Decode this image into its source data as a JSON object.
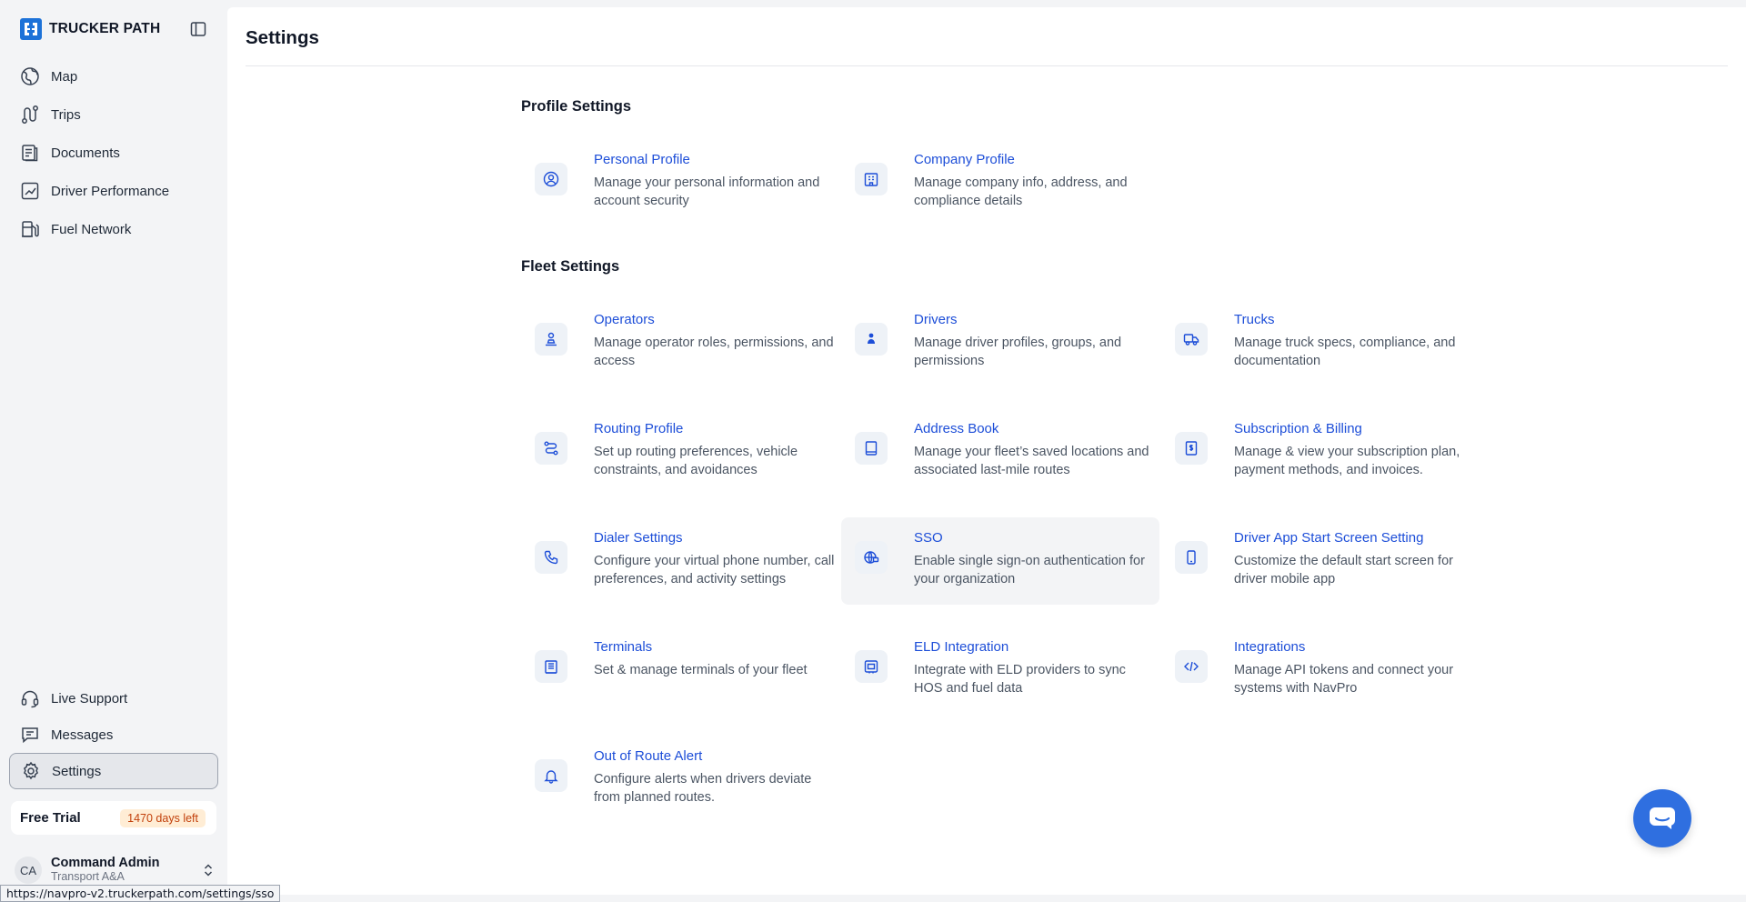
{
  "app": {
    "brand_name": "TRUCKER PATH"
  },
  "sidebar": {
    "items": [
      {
        "label": "Map",
        "icon": "globe-icon"
      },
      {
        "label": "Trips",
        "icon": "route-icon"
      },
      {
        "label": "Documents",
        "icon": "documents-icon"
      },
      {
        "label": "Driver Performance",
        "icon": "chart-icon"
      },
      {
        "label": "Fuel Network",
        "icon": "fuel-icon"
      }
    ],
    "bottom_items": [
      {
        "label": "Live Support",
        "icon": "headset-icon"
      },
      {
        "label": "Messages",
        "icon": "message-icon"
      },
      {
        "label": "Settings",
        "icon": "gear-icon",
        "active": true
      }
    ],
    "trial": {
      "label": "Free Trial",
      "badge": "1470 days left"
    },
    "user": {
      "initials": "CA",
      "name": "Command Admin",
      "org": "Transport A&A"
    }
  },
  "status_bar": {
    "url": "https://navpro-v2.truckerpath.com/settings/sso"
  },
  "page": {
    "title": "Settings",
    "profile_section": {
      "title": "Profile Settings",
      "cards": [
        {
          "title": "Personal Profile",
          "desc": "Manage your personal information and account security",
          "icon": "user-circle-icon"
        },
        {
          "title": "Company Profile",
          "desc": "Manage company info, address, and compliance details",
          "icon": "building-icon"
        }
      ]
    },
    "fleet_section": {
      "title": "Fleet Settings",
      "cards": [
        {
          "title": "Operators",
          "desc": "Manage operator roles, permissions, and access",
          "icon": "operator-icon"
        },
        {
          "title": "Drivers",
          "desc": "Manage driver profiles, groups, and permissions",
          "icon": "driver-icon"
        },
        {
          "title": "Trucks",
          "desc": "Manage truck specs, compliance, and documentation",
          "icon": "truck-icon"
        },
        {
          "title": "Routing Profile",
          "desc": "Set up routing preferences, vehicle constraints, and avoidances",
          "icon": "routing-icon"
        },
        {
          "title": "Address Book",
          "desc": "Manage your fleet’s saved locations and associated last-mile routes",
          "icon": "book-icon"
        },
        {
          "title": "Subscription & Billing",
          "desc": "Manage & view your subscription plan, payment methods, and invoices.",
          "icon": "receipt-icon"
        },
        {
          "title": "Dialer Settings",
          "desc": "Configure your virtual phone number, call preferences, and activity settings",
          "icon": "phone-icon"
        },
        {
          "title": "SSO",
          "desc": "Enable single sign-on authentication for your organization",
          "icon": "globe-lock-icon"
        },
        {
          "title": "Driver App Start Screen Setting",
          "desc": "Customize the default start screen for driver mobile app",
          "icon": "smartphone-icon"
        },
        {
          "title": "Terminals",
          "desc": "Set & manage terminals of your fleet",
          "icon": "terminal-building-icon"
        },
        {
          "title": "ELD Integration",
          "desc": "Integrate with ELD providers to sync HOS and fuel data",
          "icon": "eld-icon"
        },
        {
          "title": "Integrations",
          "desc": "Manage API tokens and connect your systems with NavPro",
          "icon": "code-icon"
        },
        {
          "title": "Out of Route Alert",
          "desc": "Configure alerts when drivers deviate from planned routes.",
          "icon": "bell-icon"
        }
      ]
    }
  },
  "colors": {
    "accent": "#1d4ed8",
    "brand": "#1d72d8",
    "chat_button": "#2f6fe0",
    "trial_badge_bg": "#ffedd5",
    "trial_badge_text": "#c2410c"
  }
}
